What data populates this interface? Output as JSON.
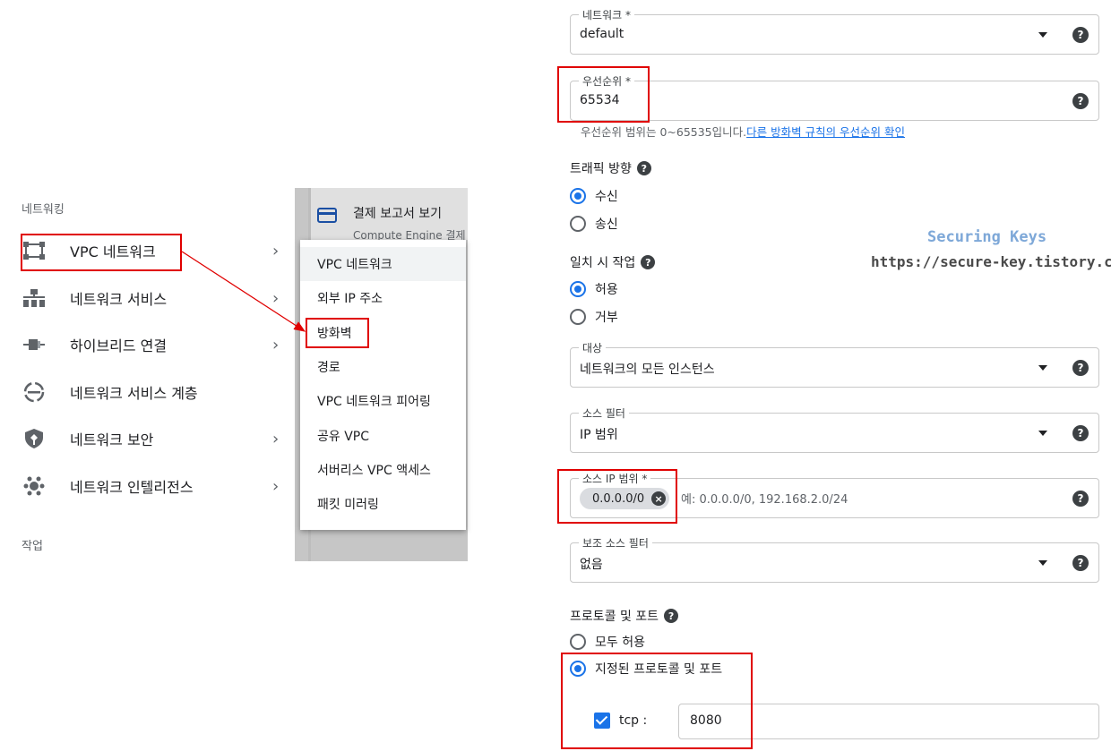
{
  "nav": {
    "section_networking": "네트워킹",
    "section_ops": "작업",
    "items": [
      {
        "label": "VPC 네트워크",
        "chevron": "›",
        "icon": "vpc-network-icon"
      },
      {
        "label": "네트워크 서비스",
        "chevron": "›",
        "icon": "network-services-icon"
      },
      {
        "label": "하이브리드 연결",
        "chevron": "›",
        "icon": "hybrid-connectivity-icon"
      },
      {
        "label": "네트워크 서비스 계층",
        "chevron": "",
        "icon": "network-tiers-icon"
      },
      {
        "label": "네트워크 보안",
        "chevron": "›",
        "icon": "network-security-icon"
      },
      {
        "label": "네트워크 인텔리전스",
        "chevron": "›",
        "icon": "network-intelligence-icon"
      }
    ]
  },
  "background_card": {
    "title": "결제 보고서 보기",
    "subtitle": "Compute Engine 결제"
  },
  "submenu": {
    "items": [
      "VPC 네트워크",
      "외부 IP 주소",
      "방화벽",
      "경로",
      "VPC 네트워크 피어링",
      "공유 VPC",
      "서버리스 VPC 액세스",
      "패킷 미러링"
    ]
  },
  "form": {
    "network": {
      "label": "네트워크 *",
      "value": "default"
    },
    "priority": {
      "label": "우선순위 *",
      "value": "65534"
    },
    "priority_hint": "우선순위 범위는 0~65535입니다.",
    "priority_link": "다른 방화벽 규칙의 우선순위 확인",
    "direction": {
      "title": "트래픽 방향",
      "options": [
        "수신",
        "송신"
      ],
      "selected": "수신"
    },
    "action": {
      "title": "일치 시 작업",
      "options": [
        "허용",
        "거부"
      ],
      "selected": "허용"
    },
    "targets": {
      "label": "대상",
      "value": "네트워크의 모든 인스턴스"
    },
    "source_filter": {
      "label": "소스 필터",
      "value": "IP 범위"
    },
    "source_ip": {
      "label": "소스 IP 범위 *",
      "chip": "0.0.0.0/0",
      "placeholder": "예: 0.0.0.0/0, 192.168.2.0/24"
    },
    "second_filter": {
      "label": "보조 소스 필터",
      "value": "없음"
    },
    "protocols": {
      "title": "프로토콜 및 포트",
      "options": [
        "모두 허용",
        "지정된 프로토콜 및 포트"
      ],
      "selected": "지정된 프로토콜 및 포트"
    },
    "tcp": {
      "label": "tcp :",
      "checked": true,
      "ports": "8080"
    },
    "help_glyph": "?",
    "dropdown_glyph": "▾",
    "chip_remove_glyph": "×"
  },
  "watermark": {
    "line1": "Securing Keys",
    "line2": "https://secure-key.tistory.com"
  },
  "colors": {
    "accent": "#1a73e8",
    "annotation": "#e00000"
  }
}
